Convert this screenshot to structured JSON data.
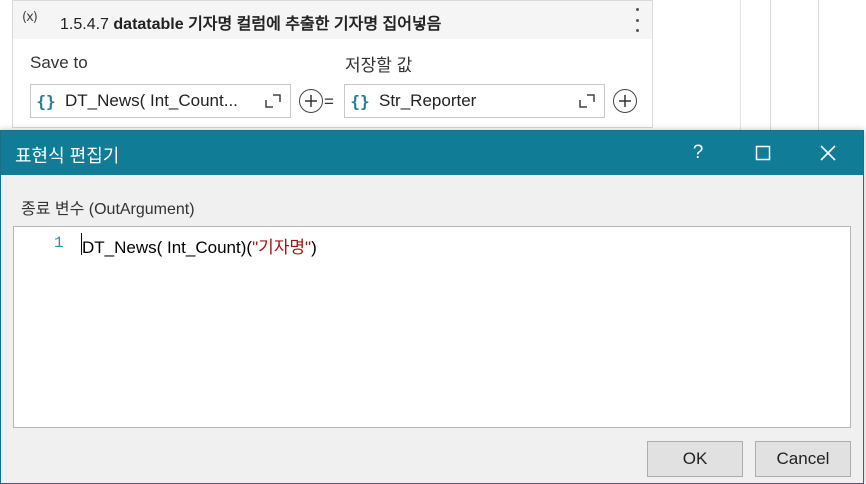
{
  "activity": {
    "icon_text": "(x)",
    "number": "1.5.4.7",
    "title": "datatable 기자명 컬럼에 추출한 기자명 집어넣음",
    "save_to_label": "Save to",
    "value_label": "저장할 값",
    "save_to_value": "DT_News( Int_Count...",
    "value_value": "Str_Reporter",
    "equals": "=",
    "brace": "{}",
    "icons": [
      "variable-icon",
      "more-options-icon",
      "brace-icon",
      "expand-icon",
      "add-circle-icon"
    ]
  },
  "dialog": {
    "title": "표현식 편집기",
    "help": "?",
    "section_label": "종료 변수 (OutArgument)",
    "line_number": "1",
    "code_prefix": "DT_News( Int_Count)(",
    "code_string": "\"기자명\"",
    "code_suffix": ")",
    "ok_label": "OK",
    "cancel_label": "Cancel",
    "colors": {
      "titlebar": "#107c96",
      "string_literal": "#a31515",
      "line_number": "#2b91af"
    }
  }
}
